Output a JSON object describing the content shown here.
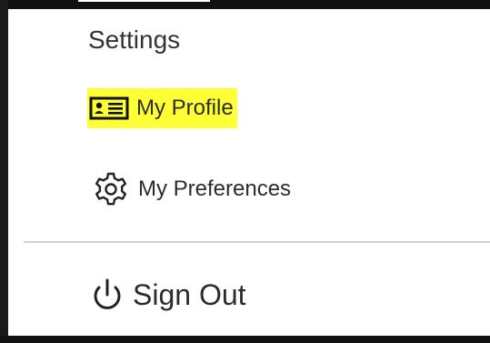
{
  "menu": {
    "heading": "Settings",
    "items": [
      {
        "label": "My Profile",
        "icon": "profile-card-icon",
        "highlighted": true,
        "highlight_color": "#ffff35"
      },
      {
        "label": "My Preferences",
        "icon": "gear-icon",
        "highlighted": false
      }
    ],
    "sign_out": {
      "label": "Sign Out",
      "icon": "power-icon"
    }
  },
  "colors": {
    "text": "#2c2c2c",
    "heading": "#333333",
    "divider": "#d4d4d4",
    "highlight": "#ffff35",
    "frame": "#111111"
  }
}
